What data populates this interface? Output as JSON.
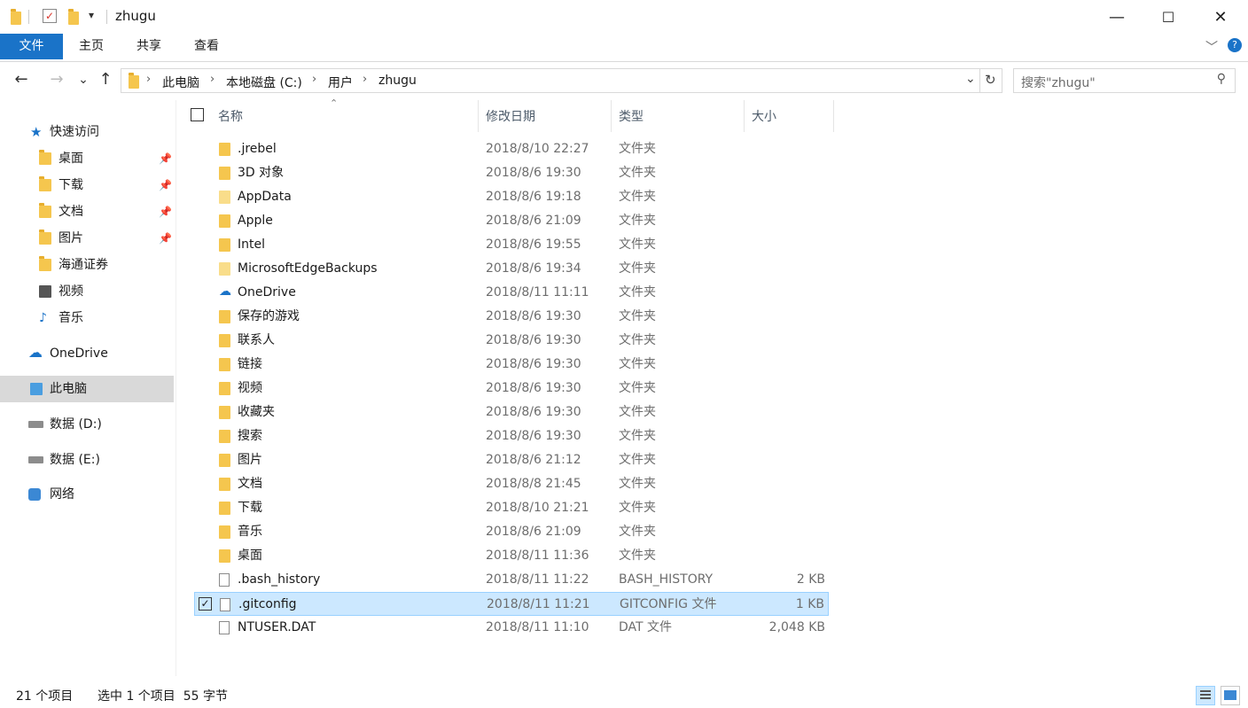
{
  "window": {
    "title": "zhugu",
    "minimize": "—",
    "maximize": "☐",
    "close": "✕"
  },
  "ribbon": {
    "tabs": [
      "文件",
      "主页",
      "共享",
      "查看"
    ]
  },
  "nav": {
    "back": "←",
    "forward": "→",
    "recent": "⌄",
    "up": "↑",
    "breadcrumb": [
      "此电脑",
      "本地磁盘 (C:)",
      "用户",
      "zhugu"
    ],
    "separator": "›",
    "search_placeholder": "搜索\"zhugu\""
  },
  "sidebar": {
    "quick_access": "快速访问",
    "pinned": [
      {
        "label": "桌面",
        "icon": "desktop-icon",
        "pinned": true
      },
      {
        "label": "下载",
        "icon": "downloads-icon",
        "pinned": true
      },
      {
        "label": "文档",
        "icon": "documents-icon",
        "pinned": true
      },
      {
        "label": "图片",
        "icon": "pictures-icon",
        "pinned": true
      },
      {
        "label": "海通证券",
        "icon": "folder-icon",
        "pinned": false
      },
      {
        "label": "视频",
        "icon": "videos-icon",
        "pinned": false
      },
      {
        "label": "音乐",
        "icon": "music-icon",
        "pinned": false
      }
    ],
    "onedrive": "OneDrive",
    "this_pc": "此电脑",
    "drive_d": "数据 (D:)",
    "drive_e": "数据 (E:)",
    "network": "网络"
  },
  "columns": {
    "name": "名称",
    "date": "修改日期",
    "type": "类型",
    "size": "大小"
  },
  "files": [
    {
      "name": ".jrebel",
      "date": "2018/8/10 22:27",
      "type": "文件夹",
      "size": "",
      "icon": "folder"
    },
    {
      "name": "3D 对象",
      "date": "2018/8/6 19:30",
      "type": "文件夹",
      "size": "",
      "icon": "folder"
    },
    {
      "name": "AppData",
      "date": "2018/8/6 19:18",
      "type": "文件夹",
      "size": "",
      "icon": "folder-pale"
    },
    {
      "name": "Apple",
      "date": "2018/8/6 21:09",
      "type": "文件夹",
      "size": "",
      "icon": "folder"
    },
    {
      "name": "Intel",
      "date": "2018/8/6 19:55",
      "type": "文件夹",
      "size": "",
      "icon": "folder"
    },
    {
      "name": "MicrosoftEdgeBackups",
      "date": "2018/8/6 19:34",
      "type": "文件夹",
      "size": "",
      "icon": "folder-pale"
    },
    {
      "name": "OneDrive",
      "date": "2018/8/11 11:11",
      "type": "文件夹",
      "size": "",
      "icon": "cloud"
    },
    {
      "name": "保存的游戏",
      "date": "2018/8/6 19:30",
      "type": "文件夹",
      "size": "",
      "icon": "folder"
    },
    {
      "name": "联系人",
      "date": "2018/8/6 19:30",
      "type": "文件夹",
      "size": "",
      "icon": "folder"
    },
    {
      "name": "链接",
      "date": "2018/8/6 19:30",
      "type": "文件夹",
      "size": "",
      "icon": "folder"
    },
    {
      "name": "视频",
      "date": "2018/8/6 19:30",
      "type": "文件夹",
      "size": "",
      "icon": "folder"
    },
    {
      "name": "收藏夹",
      "date": "2018/8/6 19:30",
      "type": "文件夹",
      "size": "",
      "icon": "folder"
    },
    {
      "name": "搜索",
      "date": "2018/8/6 19:30",
      "type": "文件夹",
      "size": "",
      "icon": "folder"
    },
    {
      "name": "图片",
      "date": "2018/8/6 21:12",
      "type": "文件夹",
      "size": "",
      "icon": "folder"
    },
    {
      "name": "文档",
      "date": "2018/8/8 21:45",
      "type": "文件夹",
      "size": "",
      "icon": "folder"
    },
    {
      "name": "下载",
      "date": "2018/8/10 21:21",
      "type": "文件夹",
      "size": "",
      "icon": "folder"
    },
    {
      "name": "音乐",
      "date": "2018/8/6 21:09",
      "type": "文件夹",
      "size": "",
      "icon": "folder"
    },
    {
      "name": "桌面",
      "date": "2018/8/11 11:36",
      "type": "文件夹",
      "size": "",
      "icon": "folder"
    },
    {
      "name": ".bash_history",
      "date": "2018/8/11 11:22",
      "type": "BASH_HISTORY",
      "size": "2 KB",
      "icon": "file"
    },
    {
      "name": ".gitconfig",
      "date": "2018/8/11 11:21",
      "type": "GITCONFIG 文件",
      "size": "1 KB",
      "icon": "file",
      "selected": true
    },
    {
      "name": "NTUSER.DAT",
      "date": "2018/8/11 11:10",
      "type": "DAT 文件",
      "size": "2,048 KB",
      "icon": "file"
    }
  ],
  "status": {
    "item_count": "21 个项目",
    "selection": "选中 1 个项目  55 字节"
  },
  "colors": {
    "accent": "#1a73c8",
    "selection_bg": "#cce8ff",
    "folder": "#f5c64e"
  }
}
